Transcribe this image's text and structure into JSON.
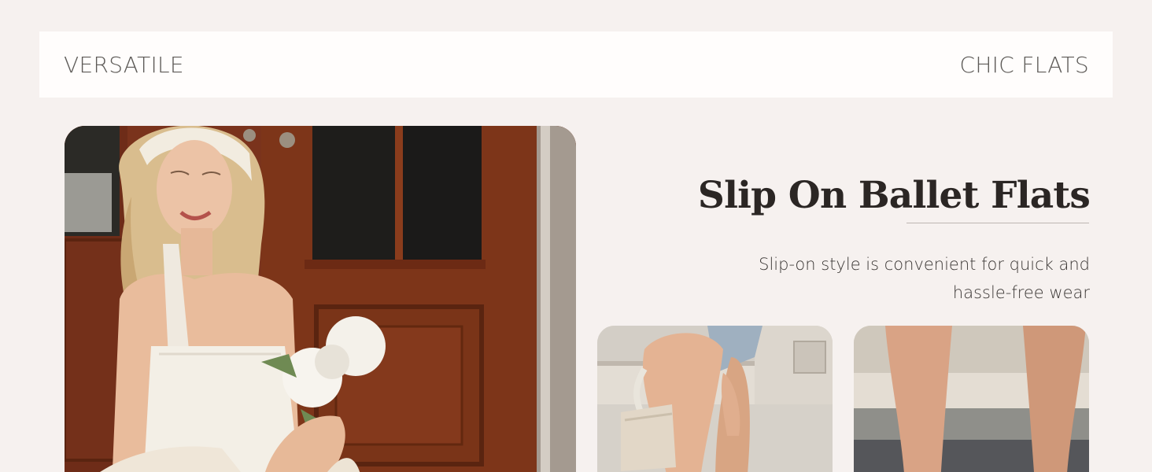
{
  "banner": {
    "left_label": "VERSATILE",
    "right_label": "CHIC FLATS"
  },
  "feature": {
    "title": "Slip On Ballet Flats",
    "description": "Slip-on style is convenient for quick and hassle-free wear"
  },
  "images": {
    "main": "model-sitting-by-wooden-door-with-flowers",
    "detail_one": "model-legs-with-handbag",
    "detail_two": "model-legs-standing"
  }
}
